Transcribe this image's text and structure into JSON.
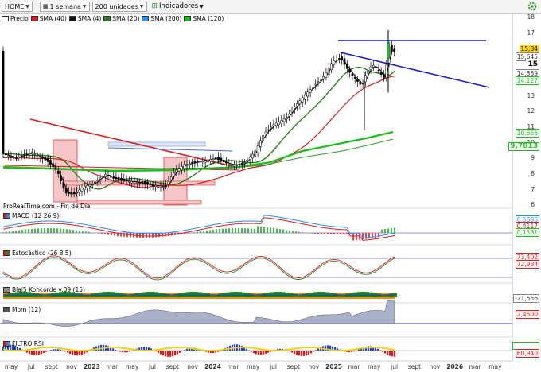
{
  "toolbar": {
    "symbol": "HOME",
    "period": "1 semana",
    "units": "200 unidades",
    "indicators": "Indicadores"
  },
  "legend": [
    {
      "label": "Precio",
      "color": "#ffffff"
    },
    {
      "label": "SMA (40)",
      "color": "#e31a1c"
    },
    {
      "label": "SMA (4)",
      "color": "#111111"
    },
    {
      "label": "SMA (20)",
      "color": "#2e7d1e"
    },
    {
      "label": "SMA (200)",
      "color": "#1e90ff"
    },
    {
      "label": "SMA (120)",
      "color": "#1dbf1d"
    }
  ],
  "watermark": "ProRealTime.com - Fin de Día",
  "price_axis": [
    "18",
    "17",
    "16",
    "15",
    "14",
    "13",
    "12",
    "11",
    "10",
    "9",
    "8",
    "7",
    "6"
  ],
  "price_tags": [
    {
      "text": "15,84",
      "bg": "#ffd400",
      "fg": "#000000",
      "border": "#b08a00"
    },
    {
      "text": "15,645",
      "bg": "#ffffff",
      "fg": "#333333",
      "border": "#888888"
    },
    {
      "text": "15",
      "bg": "#ffffff",
      "fg": "#000000",
      "border": "#ffffff"
    },
    {
      "text": "14,359",
      "bg": "#ffffff",
      "fg": "#333333",
      "border": "#888888"
    },
    {
      "text": "14,127",
      "bg": "#ffffff",
      "fg": "#1dbf1d",
      "border": "#1dbf1d"
    },
    {
      "text": "10,656",
      "bg": "#ffffff",
      "fg": "#1dbf1d",
      "border": "#1dbf1d"
    },
    {
      "text": "9,7813",
      "bg": "#ffffff",
      "fg": "#1dbf1d",
      "border": "#1dbf1d"
    }
  ],
  "panels": {
    "macd": {
      "label": "MACD (12 26 9)",
      "values": [
        "0,5696",
        "0,4117",
        "0,1581"
      ]
    },
    "stoch": {
      "label": "Estocástico (26 8 5)",
      "values": [
        "73,402",
        "72,984"
      ]
    },
    "blai": {
      "label": "Blai5 Koncorde v.09 (15)",
      "values": [
        "-21,556"
      ]
    },
    "mom": {
      "label": "Mom (12)",
      "values": [
        "2,4500"
      ]
    },
    "filtro": {
      "label": "FILTRO RSI",
      "values": [
        "",
        "60,940"
      ]
    }
  },
  "x_labels": [
    "may",
    "jul",
    "sept",
    "nov",
    "2023",
    "mar",
    "may",
    "jul",
    "sept",
    "nov",
    "2024",
    "mar",
    "may",
    "jul",
    "sept",
    "nov",
    "2025",
    "mar",
    "may",
    "jul",
    "sept",
    "nov",
    "2026",
    "mar",
    "may"
  ],
  "x_bold": [
    "2023",
    "2024",
    "2025",
    "2026"
  ],
  "colors": {
    "sma40": "#e31a1c",
    "sma4": "#111111",
    "sma20": "#2e7d1e",
    "sma200": "#1e90ff",
    "sma120": "#1dbf1d",
    "trend_blue": "#1a1ad6",
    "trend_red": "#e31a1c"
  }
}
